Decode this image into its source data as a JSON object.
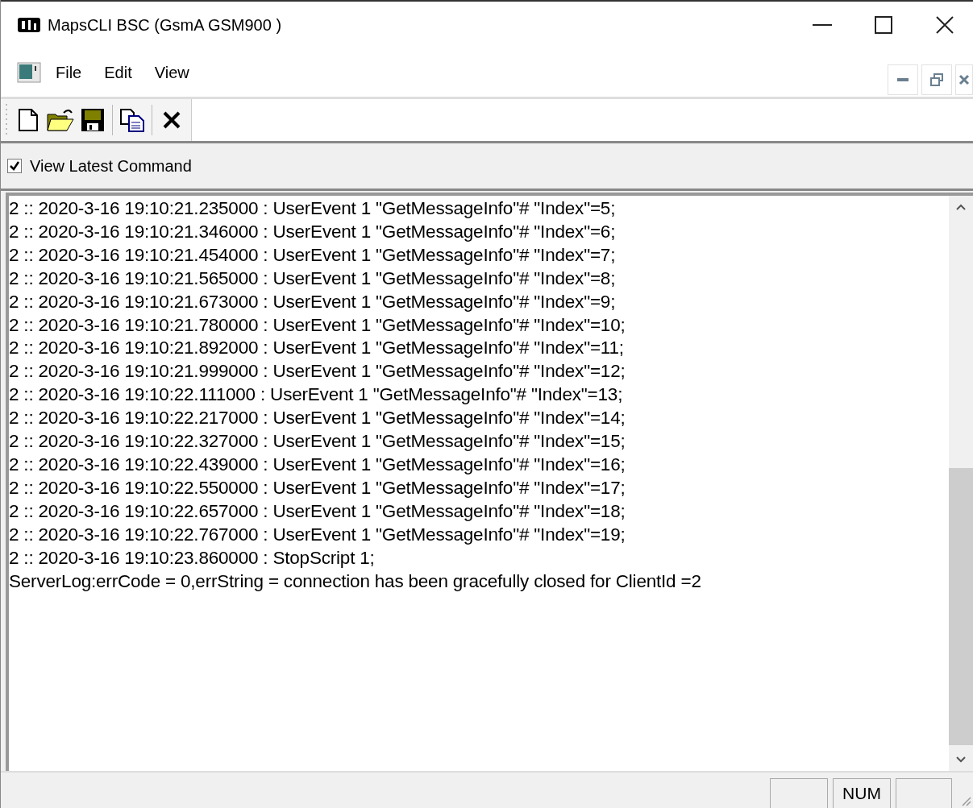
{
  "window": {
    "title": "MapsCLI BSC (GsmA GSM900 )"
  },
  "menu": {
    "items": [
      {
        "label": "File"
      },
      {
        "label": "Edit"
      },
      {
        "label": "View"
      }
    ]
  },
  "options": {
    "view_latest": {
      "label": "View Latest Command",
      "checked": true
    }
  },
  "log": {
    "lines": [
      "2 :: 2020-3-16 19:10:21.235000 : UserEvent 1 \"GetMessageInfo\"# \"Index\"=5;",
      "2 :: 2020-3-16 19:10:21.346000 : UserEvent 1 \"GetMessageInfo\"# \"Index\"=6;",
      "2 :: 2020-3-16 19:10:21.454000 : UserEvent 1 \"GetMessageInfo\"# \"Index\"=7;",
      "2 :: 2020-3-16 19:10:21.565000 : UserEvent 1 \"GetMessageInfo\"# \"Index\"=8;",
      "2 :: 2020-3-16 19:10:21.673000 : UserEvent 1 \"GetMessageInfo\"# \"Index\"=9;",
      "2 :: 2020-3-16 19:10:21.780000 : UserEvent 1 \"GetMessageInfo\"# \"Index\"=10;",
      "2 :: 2020-3-16 19:10:21.892000 : UserEvent 1 \"GetMessageInfo\"# \"Index\"=11;",
      "2 :: 2020-3-16 19:10:21.999000 : UserEvent 1 \"GetMessageInfo\"# \"Index\"=12;",
      "2 :: 2020-3-16 19:10:22.111000 : UserEvent 1 \"GetMessageInfo\"# \"Index\"=13;",
      "2 :: 2020-3-16 19:10:22.217000 : UserEvent 1 \"GetMessageInfo\"# \"Index\"=14;",
      "2 :: 2020-3-16 19:10:22.327000 : UserEvent 1 \"GetMessageInfo\"# \"Index\"=15;",
      "2 :: 2020-3-16 19:10:22.439000 : UserEvent 1 \"GetMessageInfo\"# \"Index\"=16;",
      "2 :: 2020-3-16 19:10:22.550000 : UserEvent 1 \"GetMessageInfo\"# \"Index\"=17;",
      "2 :: 2020-3-16 19:10:22.657000 : UserEvent 1 \"GetMessageInfo\"# \"Index\"=18;",
      "2 :: 2020-3-16 19:10:22.767000 : UserEvent 1 \"GetMessageInfo\"# \"Index\"=19;",
      "2 :: 2020-3-16 19:10:23.860000 : StopScript 1;",
      "ServerLog:errCode = 0,errString = connection has been gracefully closed for ClientId =2"
    ]
  },
  "status_bar": {
    "panes": [
      {
        "kind": "empty"
      },
      {
        "kind": "text",
        "text": "NUM"
      },
      {
        "kind": "empty"
      }
    ]
  }
}
